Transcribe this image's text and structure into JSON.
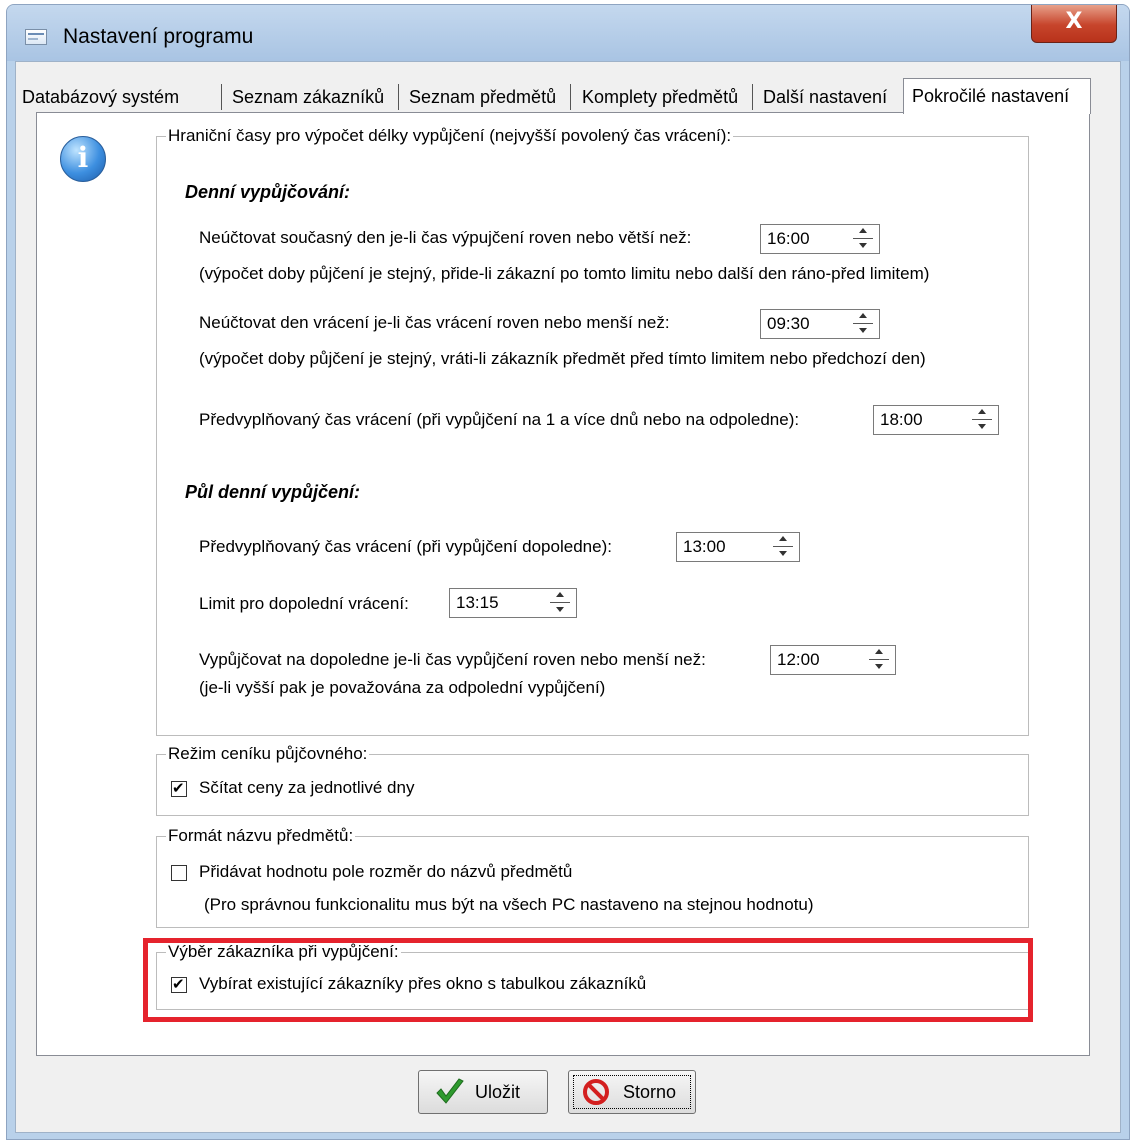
{
  "window": {
    "title": "Nastavení programu",
    "close_label": "X"
  },
  "tabs": [
    "Databázový systém",
    "Seznam zákazníků",
    "Seznam předmětů",
    "Komplety předmětů",
    "Další nastavení",
    "Pokročilé nastavení"
  ],
  "active_tab": "Pokročilé nastavení",
  "info_icon_glyph": "i",
  "groups": {
    "limits": {
      "legend": "Hraniční časy pro výpočet délky vypůjčení (nejvyšší povolený čas vrácení):",
      "daily_heading": "Denní vypůjčování:",
      "no_charge_today_label": "Neúčtovat současný den je-li čas výpujčení roven nebo větší než:",
      "no_charge_today_value": "16:00",
      "no_charge_today_note": "(výpočet doby půjčení je stejný, přide-li zákazní po tomto limitu nebo další den ráno-před limitem)",
      "no_charge_return_label": "Neúčtovat den vrácení je-li čas vrácení roven nebo menší než:",
      "no_charge_return_value": "09:30",
      "no_charge_return_note": "(výpočet doby půjčení je stejný, vráti-li zákazník předmět před tímto limitem nebo předchozí den)",
      "prefill_return_label": "Předvyplňovaný čas vrácení (při vypůjčení na 1 a více dnů nebo na odpoledne):",
      "prefill_return_value": "18:00",
      "half_day_heading": "Půl denní vypůjčení:",
      "prefill_morning_label": "Předvyplňovaný čas vrácení (při vypůjčení dopoledne):",
      "prefill_morning_value": "13:00",
      "morning_limit_label": "Limit pro dopolední vrácení:",
      "morning_limit_value": "13:15",
      "morning_rent_label": "Vypůjčovat na dopoledne je-li čas vypůjčení roven nebo menší než:",
      "morning_rent_value": "12:00",
      "morning_rent_note": "(je-li vyšší pak je považována za odpolední vypůjčení)"
    },
    "pricing": {
      "legend": "Režim ceníku půjčovného:",
      "sum_prices_label": "Sčítat ceny za jednotlivé dny",
      "sum_prices_checked": true
    },
    "format": {
      "legend": "Formát názvu předmětů:",
      "add_size_label": "Přidávat hodnotu pole rozměr do názvů předmětů",
      "add_size_checked": false,
      "add_size_note": "(Pro správnou funkcionalitu mus být na všech PC nastaveno na stejnou hodnotu)"
    },
    "customer": {
      "legend": "Výběr zákazníka při vypůjčení:",
      "select_existing_label": "Vybírat existující zákazníky přes okno s tabulkou zákazníků",
      "select_existing_checked": true
    }
  },
  "buttons": {
    "save": "Uložit",
    "cancel": "Storno"
  },
  "colors": {
    "highlight": "#e5232d",
    "titlebar": "#b9d1ea",
    "close": "#c7452c"
  }
}
